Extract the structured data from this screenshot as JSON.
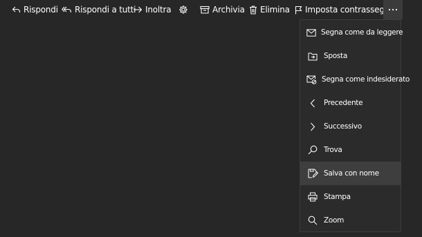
{
  "toolbar": {
    "reply": {
      "label": "Rispondi",
      "icon": "reply-icon"
    },
    "reply_all": {
      "label": "Rispondi a tutti",
      "icon": "reply-all-icon"
    },
    "forward": {
      "label": "Inoltra",
      "icon": "forward-icon"
    },
    "settings": {
      "icon": "gear-icon"
    },
    "archive": {
      "label": "Archivia",
      "icon": "archive-icon"
    },
    "delete": {
      "label": "Elimina",
      "icon": "trash-icon"
    },
    "flag": {
      "label": "Imposta contrassegno",
      "icon": "flag-icon"
    },
    "more": {
      "label": "···",
      "icon": "more-icon"
    }
  },
  "menu": {
    "items": [
      {
        "label": "Segna come da leggere",
        "icon": "envelope-icon"
      },
      {
        "label": "Sposta",
        "icon": "move-folder-icon"
      },
      {
        "label": "Segna come indesiderato",
        "icon": "junk-mail-icon"
      },
      {
        "label": "Precedente",
        "icon": "chevron-left-icon"
      },
      {
        "label": "Successivo",
        "icon": "chevron-right-icon"
      },
      {
        "label": "Trova",
        "icon": "search-icon"
      },
      {
        "label": "Salva con nome",
        "icon": "save-as-icon"
      },
      {
        "label": "Stampa",
        "icon": "printer-icon"
      },
      {
        "label": "Zoom",
        "icon": "zoom-icon"
      }
    ],
    "highlighted_item": "Salva con nome"
  },
  "colors": {
    "background": "#272727",
    "menu_background": "#2b2b2b",
    "menu_hover": "#3e3e3e",
    "more_button_background": "#3b3b3b",
    "text": "#ffffff"
  }
}
